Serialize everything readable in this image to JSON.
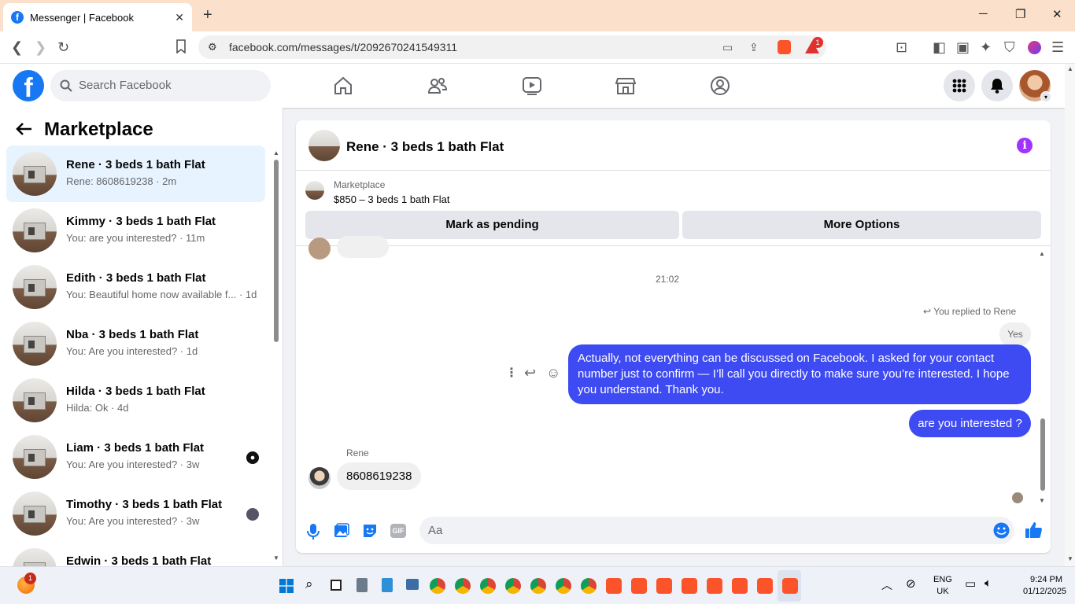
{
  "browser": {
    "tab_title": "Messenger | Facebook",
    "url": "facebook.com/messages/t/2092670241549311",
    "shield_badge": "1"
  },
  "fb": {
    "search_placeholder": "Search Facebook"
  },
  "sidebar": {
    "title": "Marketplace",
    "conversations": [
      {
        "name": "Rene · 3 beds 1 bath Flat",
        "preview": "Rene: 8608619238 · 2m",
        "active": true
      },
      {
        "name": "Kimmy · 3 beds 1 bath Flat",
        "preview": "You: are you interested? · 11m"
      },
      {
        "name": "Edith · 3 beds 1 bath Flat",
        "preview": "You: Beautiful home now available f... · 1d"
      },
      {
        "name": "Nba · 3 beds 1 bath Flat",
        "preview": "You: Are you interested? · 1d"
      },
      {
        "name": "Hilda · 3 beds 1 bath Flat",
        "preview": "Hilda: Ok · 4d"
      },
      {
        "name": "Liam · 3 beds 1 bath Flat",
        "preview": "You: Are you interested? · 3w"
      },
      {
        "name": "Timothy · 3 beds 1 bath Flat",
        "preview": "You: Are you interested? · 3w"
      },
      {
        "name": "Edwin · 3 beds 1 bath Flat",
        "preview": ""
      }
    ]
  },
  "chat": {
    "header_name": "Rene · 3 beds 1 bath Flat",
    "listing_label": "Marketplace",
    "listing_title": "$850 – 3 beds 1 bath Flat",
    "mark_pending": "Mark as pending",
    "more_options": "More Options",
    "time_separator": "21:02",
    "replied_to": "You replied to Rene",
    "quoted": "Yes",
    "message_long": "Actually, not everything can be discussed on Facebook. I asked for your contact number just to confirm — I’ll call you directly to make sure you’re interested. I hope you understand. Thank you.",
    "message_short": "are you interested ?",
    "sender_label": "Rene",
    "incoming": "8608619238",
    "composer_placeholder": "Aa",
    "gif_label": "GIF"
  },
  "taskbar": {
    "lang_top": "ENG",
    "lang_bottom": "UK",
    "time": "9:24 PM",
    "date": "01/12/2025",
    "notif_badge": "1"
  },
  "colors": {
    "fb_blue": "#1877f2",
    "bubble_out": "#3e4af2",
    "active_row": "#e7f3ff",
    "info_purple": "#a033ff"
  }
}
